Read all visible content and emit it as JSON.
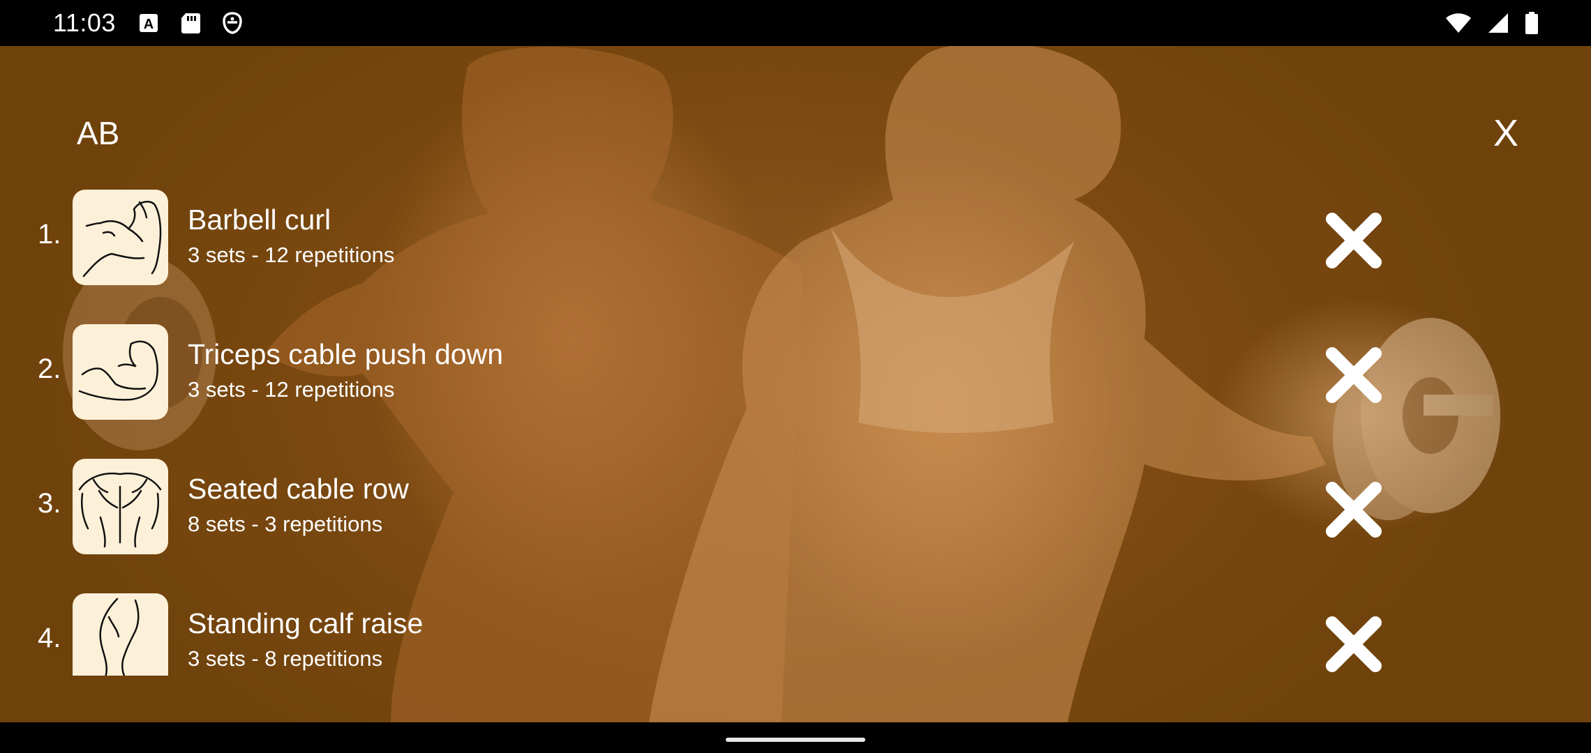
{
  "status_bar": {
    "time": "11:03",
    "left_icons": [
      "a-notification-icon",
      "sd-card-icon",
      "shield-app-icon"
    ],
    "right_icons": [
      "wifi-icon",
      "cell-signal-icon",
      "battery-icon"
    ]
  },
  "header": {
    "title": "AB",
    "close_label": "X"
  },
  "exercises": [
    {
      "index": "1.",
      "name": "Barbell curl",
      "detail": "3 sets - 12 repetitions",
      "icon": "biceps-icon"
    },
    {
      "index": "2.",
      "name": "Triceps cable push down",
      "detail": "3 sets - 12 repetitions",
      "icon": "triceps-icon"
    },
    {
      "index": "3.",
      "name": "Seated cable row",
      "detail": "8 sets - 3 repetitions",
      "icon": "back-muscles-icon"
    },
    {
      "index": "4.",
      "name": "Standing calf raise",
      "detail": "3 sets - 8 repetitions",
      "icon": "calf-icon"
    }
  ],
  "colors": {
    "overlay": "#7a4810",
    "thumb_bg": "#fdf0d8",
    "text": "#ffffff"
  }
}
